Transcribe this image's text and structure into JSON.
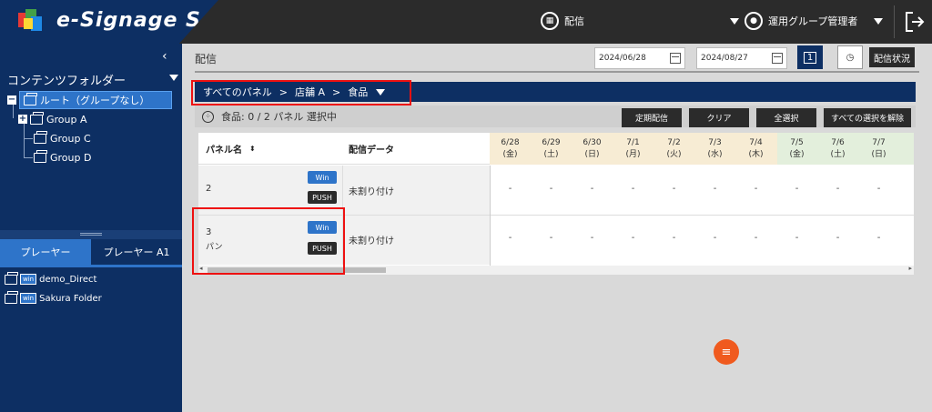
{
  "app": {
    "title": "e-Signage S"
  },
  "topbar": {
    "distribution_label": "配信",
    "user_label": "運用グループ管理者"
  },
  "sidebar": {
    "folder_header": "コンテンツフォルダー",
    "tree": [
      {
        "label": "ルート（グループなし）",
        "selected": true
      },
      {
        "label": "Group A"
      },
      {
        "label": "Group C"
      },
      {
        "label": "Group D"
      }
    ],
    "player_tabs": [
      "プレーヤー",
      "プレーヤー A1"
    ],
    "players": [
      {
        "badge": "win",
        "label": "demo_Direct"
      },
      {
        "badge": "win",
        "label": "Sakura Folder"
      }
    ]
  },
  "main": {
    "title": "配信",
    "date_from": "2024/06/28",
    "date_to": "2024/08/27",
    "cal_day": "1",
    "status_btn": "配信状況",
    "breadcrumb": [
      "すべてのパネル",
      "店舗 A",
      "食品"
    ],
    "breadcrumb_sep": ">",
    "selection_text": "食品: 0 / 2 パネル 選択中",
    "actions": [
      "定期配信",
      "クリア",
      "全選択",
      "すべての選択を解除"
    ],
    "grid": {
      "col_panel": "パネル名",
      "col_data": "配信データ",
      "dates": [
        {
          "d": "6/28",
          "w": "(金)"
        },
        {
          "d": "6/29",
          "w": "(土)"
        },
        {
          "d": "6/30",
          "w": "(日)"
        },
        {
          "d": "7/1",
          "w": "(月)"
        },
        {
          "d": "7/2",
          "w": "(火)"
        },
        {
          "d": "7/3",
          "w": "(水)"
        },
        {
          "d": "7/4",
          "w": "(木)"
        },
        {
          "d": "7/5",
          "w": "(金)"
        },
        {
          "d": "7/6",
          "w": "(土)"
        },
        {
          "d": "7/7",
          "w": "(日)"
        }
      ],
      "rows": [
        {
          "name": "2",
          "sub": "",
          "tag1": "Win",
          "tag2": "PUSH",
          "data": "未割り付け",
          "cell": "-"
        },
        {
          "name": "3",
          "sub": "パン",
          "tag1": "Win",
          "tag2": "PUSH",
          "data": "未割り付け",
          "cell": "-"
        }
      ]
    }
  },
  "colors": {
    "nav": "#0d2f63",
    "accent": "#2e74c9",
    "highlight": "#e11111",
    "fab": "#f05a1e"
  }
}
